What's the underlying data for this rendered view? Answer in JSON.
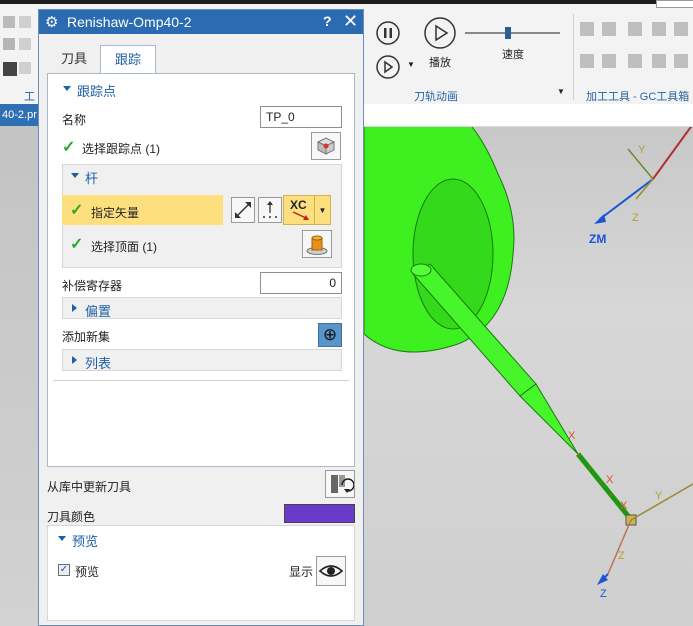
{
  "ribbon": {
    "play_label": "播放",
    "speed_label": "速度",
    "group_toolpath_anim": "刀轨动画",
    "group_gc_toolbox": "加工工具 - GC工具箱",
    "left_group_label": "工",
    "file_tab_fragment": "40-2.pr"
  },
  "dialog": {
    "title": "Renishaw-Omp40-2",
    "help": "?",
    "close": "✕",
    "tabs": {
      "tool": "刀具",
      "track": "跟踪"
    },
    "track_point": {
      "header": "跟踪点",
      "name_label": "名称",
      "name_value": "TP_0",
      "select_point_label": "选择跟踪点 (1)"
    },
    "shank": {
      "header": "杆",
      "specify_vector_label": "指定矢量",
      "vector_type": "XC",
      "select_top_face_label": "选择顶面 (1)"
    },
    "comp_register_label": "补偿寄存器",
    "comp_register_value": "0",
    "offset_header": "偏置",
    "add_new_set_label": "添加新集",
    "list_header": "列表",
    "update_from_library_label": "从库中更新刀具",
    "tool_color_label": "刀具颜色",
    "tool_color": "#6a3acb",
    "preview": {
      "header": "预览",
      "checkbox_label": "预览",
      "show_label": "显示"
    }
  },
  "viewport": {
    "axis_zm": "ZM",
    "axis_x1": "X",
    "axis_x2": "X",
    "axis_y1": "Y",
    "axis_y2": "Y",
    "axis_z1": "Z",
    "axis_z2": "Z",
    "axis_z3": "Z",
    "tool_color": "#3ef01f"
  }
}
